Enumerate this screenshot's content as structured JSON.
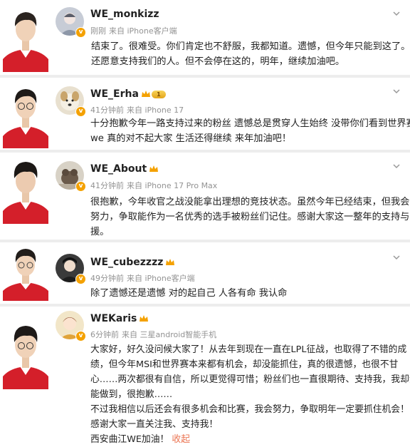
{
  "posts": [
    {
      "username": "WE_monkizz",
      "time": "刚刚",
      "source": "来自 iPhone客户端",
      "lines": [
        "结束了。很难受。你们肯定也不舒服，我都知道。遗憾，但今年只能到这了。谢谢",
        "还愿意支持我们的人。但不会停在这的，明年，继续加油吧。"
      ]
    },
    {
      "username": "WE_Erha",
      "level": "1",
      "time": "41分钟前",
      "source": "来自 iPhone 17",
      "lines": [
        "十分抱歉今年一路支持过来的粉丝 遗憾总是贯穿人生始终 没带你们看到世界赛的",
        "we 真的对不起大家 生活还得继续 来年加油吧！"
      ]
    },
    {
      "username": "WE_About",
      "time": "41分钟前",
      "source": "来自 iPhone 17 Pro Max",
      "lines": [
        "很抱歉，今年收官之战没能拿出理想的竞技状态。虽然今年已经结束，但我会继续",
        "努力，争取能作为一名优秀的选手被粉丝们记住。感谢大家这一整年的支持与应",
        "援。"
      ]
    },
    {
      "username": "WE_cubezzzz",
      "time": "49分钟前",
      "source": "来自 iPhone客户端",
      "lines": [
        "除了遗憾还是遗憾 对的起自己 人各有命 我认命"
      ]
    },
    {
      "username": "WEKaris",
      "time": "6分钟前",
      "source": "来自 三星android智能手机",
      "lines": [
        "大家好，好久没问候大家了！从去年到现在一直在LPL征战，也取得了不错的成",
        "绩，但今年MSI和世界赛本来都有机会，却没能抓住，真的很遗憾，也很不甘",
        "心……两次都很有自信，所以更觉得可惜；粉丝们也一直很期待、支持我，我却没",
        "能做到，很抱歉……",
        "不过我相信以后还会有很多机会和比赛，我会努力，争取明年一定要抓住机会！",
        "感谢大家一直关注我、支持我！",
        "西安曲江WE加油！"
      ],
      "collapse_label": "收起"
    }
  ],
  "colors": {
    "accent": "#eb7350",
    "meta": "#939393",
    "jersey": "#d41f2a",
    "badge": "#f4a100"
  },
  "icons": [
    "chevron-down-icon",
    "crown-icon",
    "verified-badge-icon"
  ]
}
